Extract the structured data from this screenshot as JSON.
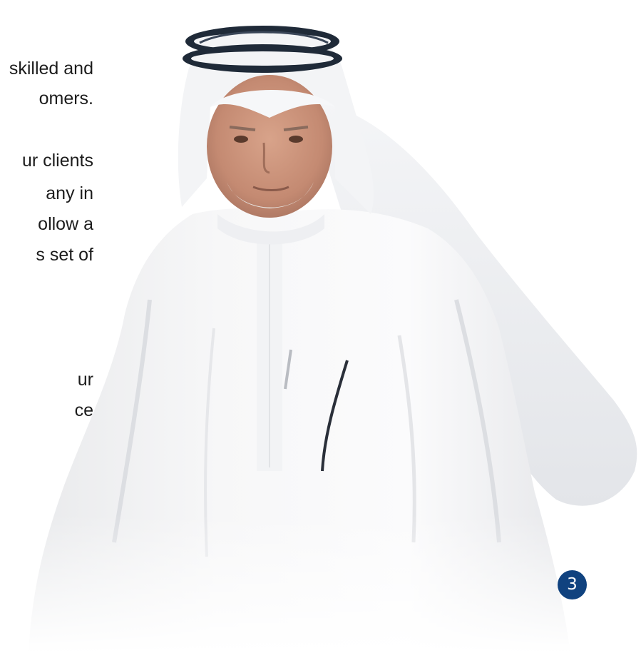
{
  "body_text": {
    "lines": [
      "skilled and",
      "omers.",
      "ur clients",
      "any in",
      "ollow a",
      "s set of",
      "ur",
      "ce"
    ]
  },
  "photo": {
    "alt": "Portrait of a man in a white thobe and ghutra with black agal"
  },
  "page_badge": "3",
  "colors": {
    "badge_background": "#10427f",
    "text": "#1c1c1c",
    "agal": "#1f2a38"
  }
}
